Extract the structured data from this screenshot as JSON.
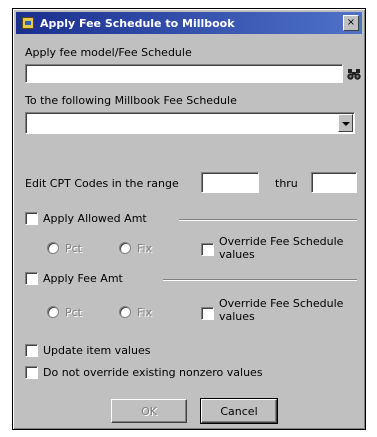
{
  "window": {
    "title": "Apply Fee Schedule to Millbook",
    "close_glyph": "×",
    "icon": "app-icon",
    "accent": "#1a2f8f"
  },
  "form": {
    "apply_label": "Apply fee model/Fee Schedule",
    "apply_value": "",
    "lookup_icon": "binoculars-icon",
    "to_label": "To the following Millbook Fee Schedule",
    "to_value": ""
  },
  "range": {
    "label": "Edit CPT Codes in the range",
    "thru_label": "thru",
    "from_value": "",
    "thru_value": ""
  },
  "allowed": {
    "label": "Apply Allowed Amt",
    "checked": false,
    "opt_pct": "Pct",
    "opt_fix": "Fix",
    "override_label": "Override Fee Schedule values"
  },
  "fee": {
    "label": "Apply Fee Amt",
    "checked": false,
    "opt_pct": "Pct",
    "opt_fix": "Fix",
    "override_label": "Override Fee Schedule values"
  },
  "options": {
    "update_label": "Update item values",
    "preserve_label": "Do not override existing nonzero values"
  },
  "buttons": {
    "ok": "OK",
    "cancel": "Cancel"
  }
}
